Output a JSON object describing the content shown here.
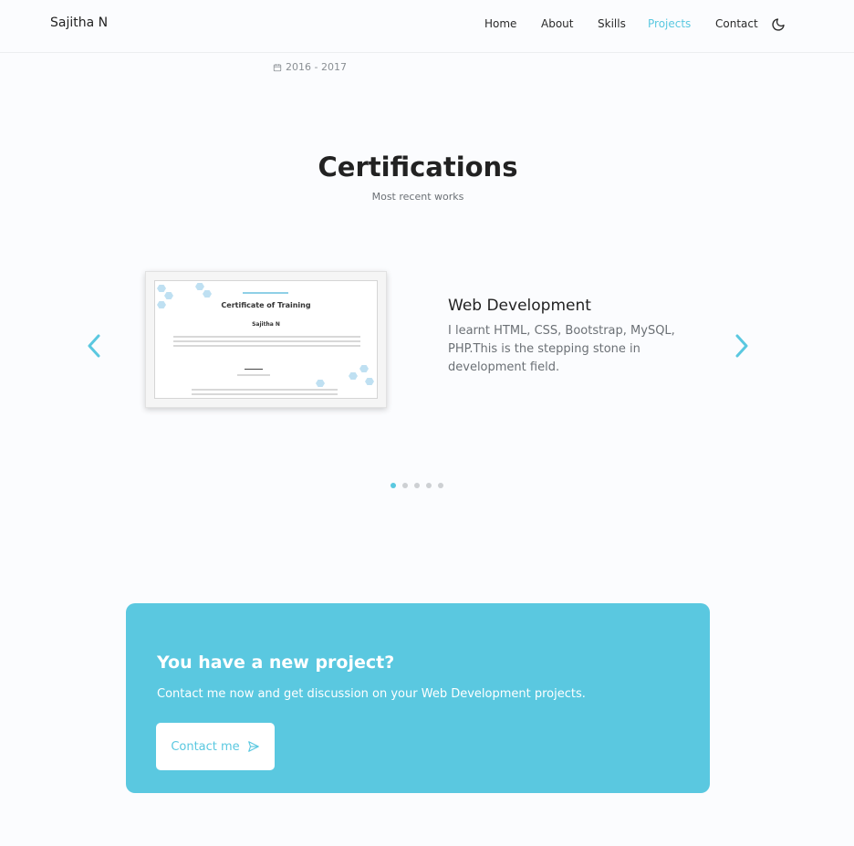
{
  "header": {
    "brand": "Sajitha N",
    "nav": [
      {
        "label": "Home",
        "active": false
      },
      {
        "label": "About",
        "active": false
      },
      {
        "label": "Skills",
        "active": false
      },
      {
        "label": "Projects",
        "active": true
      },
      {
        "label": "Contact",
        "active": false
      }
    ],
    "theme_icon": "moon-icon"
  },
  "previous_section": {
    "date": "2016 - 2017",
    "date_icon": "calendar-icon"
  },
  "certifications": {
    "title": "Certifications",
    "subtitle": "Most recent works",
    "slide": {
      "certificate_title": "Certificate of Training",
      "certificate_name": "Sajitha N",
      "title": "Web Development",
      "description": "I learnt HTML, CSS, Bootstrap, MySQL, PHP.This is the stepping stone in development field."
    },
    "slide_count": 5,
    "active_slide": 1,
    "prev_icon": "chevron-left-icon",
    "next_icon": "chevron-right-icon"
  },
  "cta": {
    "title": "You have a new project?",
    "text": "Contact me now and get discussion on your Web Development projects.",
    "button_label": "Contact me",
    "button_icon": "send-icon"
  },
  "colors": {
    "accent": "#5ac8e0",
    "background": "#fbfcfe",
    "text": "#222222",
    "muted": "#6b7075"
  }
}
